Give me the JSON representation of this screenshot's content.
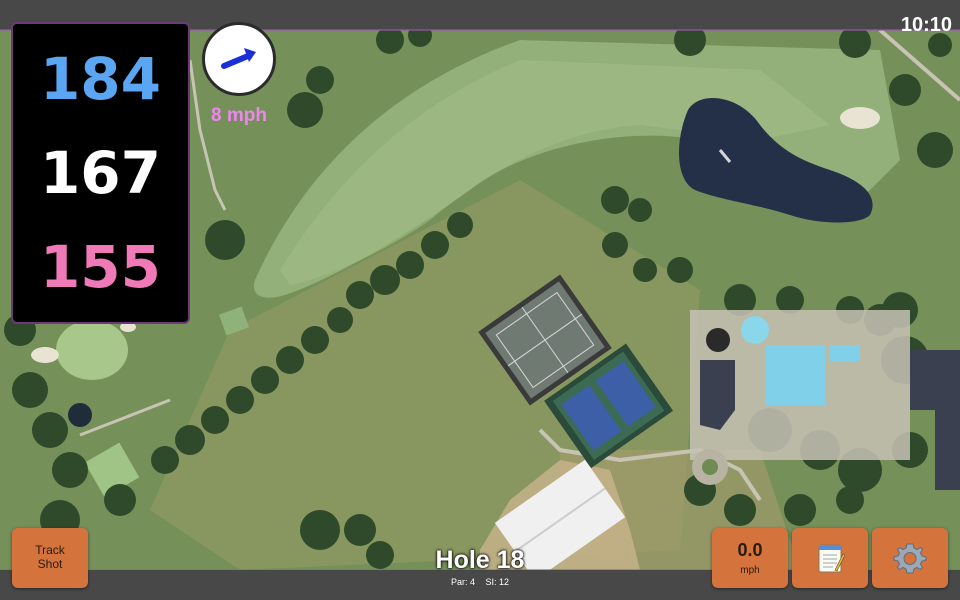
{
  "status": {
    "time": "10:10"
  },
  "distances": {
    "back": "184",
    "middle": "167",
    "front": "155",
    "colors": {
      "back": "#5aa6f2",
      "middle": "#ffffff",
      "front": "#f07ab8"
    }
  },
  "wind": {
    "speed_label": "8 mph",
    "arrow_icon": "wind-direction-arrow",
    "label_color": "#ee86f0"
  },
  "buttons": {
    "track_shot": "Track\nShot",
    "speed_value": "0.0",
    "speed_unit": "mph",
    "notes_icon": "notepad-icon",
    "settings_icon": "gear-icon",
    "color": "#d4733c"
  },
  "hole": {
    "title": "Hole 18",
    "par": "Par: 4",
    "si": "SI: 12"
  }
}
